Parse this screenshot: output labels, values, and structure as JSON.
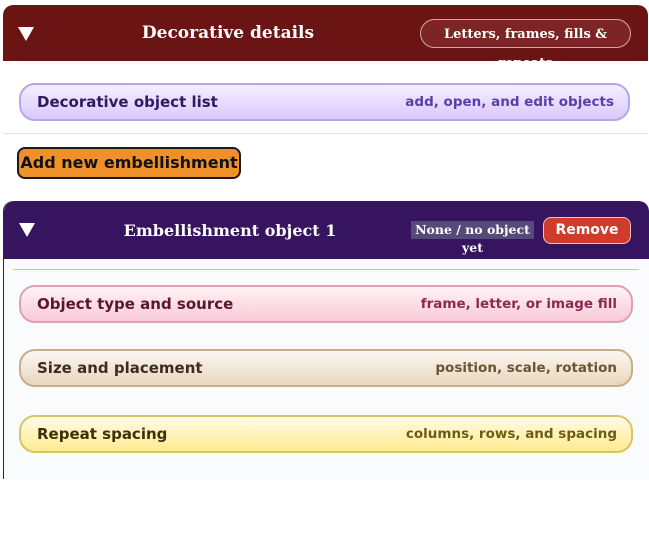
{
  "decorative": {
    "title": "Decorative details",
    "badge": "Letters, frames, fills & repeats",
    "object_list": {
      "label": "Decorative object list",
      "hint": "add, open, and edit objects"
    },
    "add_button": "Add new embellishment"
  },
  "embellishment": {
    "title": "Embellishment object 1",
    "status": "None / no object yet",
    "remove_button": "Remove",
    "sections": {
      "type": {
        "label": "Object type and source",
        "hint": "frame, letter, or image fill"
      },
      "size": {
        "label": "Size and placement",
        "hint": "position, scale, rotation"
      },
      "repeat": {
        "label": "Repeat spacing",
        "hint": "columns, rows, and spacing"
      }
    }
  },
  "icons": {
    "collapse": "triangle-down-icon"
  },
  "colors": {
    "decorative_header": "#6b1414",
    "embellishment_header": "#36145f",
    "add_button": "#f0902a",
    "remove_button": "#d13b2b"
  }
}
